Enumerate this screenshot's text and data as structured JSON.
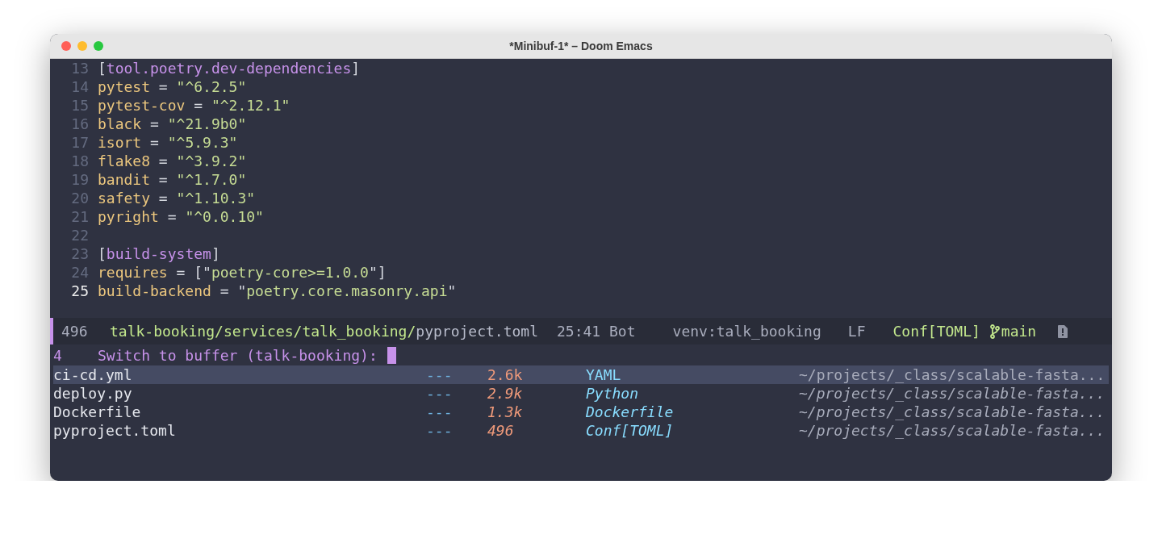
{
  "window": {
    "title": "*Minibuf-1* – Doom Emacs"
  },
  "editor": {
    "lines": [
      {
        "number": "13",
        "current": false,
        "tokens": [
          {
            "kind": "punct",
            "text": "["
          },
          {
            "kind": "section",
            "text": "tool.poetry.dev-dependencies"
          },
          {
            "kind": "punct",
            "text": "]"
          }
        ]
      },
      {
        "number": "14",
        "current": false,
        "tokens": [
          {
            "kind": "key",
            "text": "pytest"
          },
          {
            "kind": "punct",
            "text": " = "
          },
          {
            "kind": "string",
            "text": "\"^6.2.5\""
          }
        ]
      },
      {
        "number": "15",
        "current": false,
        "tokens": [
          {
            "kind": "key",
            "text": "pytest-cov"
          },
          {
            "kind": "punct",
            "text": " = "
          },
          {
            "kind": "string",
            "text": "\"^2.12.1\""
          }
        ]
      },
      {
        "number": "16",
        "current": false,
        "tokens": [
          {
            "kind": "key",
            "text": "black"
          },
          {
            "kind": "punct",
            "text": " = "
          },
          {
            "kind": "string",
            "text": "\"^21.9b0\""
          }
        ]
      },
      {
        "number": "17",
        "current": false,
        "tokens": [
          {
            "kind": "key",
            "text": "isort"
          },
          {
            "kind": "punct",
            "text": " = "
          },
          {
            "kind": "string",
            "text": "\"^5.9.3\""
          }
        ]
      },
      {
        "number": "18",
        "current": false,
        "tokens": [
          {
            "kind": "key",
            "text": "flake8"
          },
          {
            "kind": "punct",
            "text": " = "
          },
          {
            "kind": "string",
            "text": "\"^3.9.2\""
          }
        ]
      },
      {
        "number": "19",
        "current": false,
        "tokens": [
          {
            "kind": "key",
            "text": "bandit"
          },
          {
            "kind": "punct",
            "text": " = "
          },
          {
            "kind": "string",
            "text": "\"^1.7.0\""
          }
        ]
      },
      {
        "number": "20",
        "current": false,
        "tokens": [
          {
            "kind": "key",
            "text": "safety"
          },
          {
            "kind": "punct",
            "text": " = "
          },
          {
            "kind": "string",
            "text": "\"^1.10.3\""
          }
        ]
      },
      {
        "number": "21",
        "current": false,
        "tokens": [
          {
            "kind": "key",
            "text": "pyright"
          },
          {
            "kind": "punct",
            "text": " = "
          },
          {
            "kind": "string",
            "text": "\"^0.0.10\""
          }
        ]
      },
      {
        "number": "22",
        "current": false
      },
      {
        "number": "23",
        "current": false,
        "tokens": [
          {
            "kind": "punct",
            "text": "["
          },
          {
            "kind": "section",
            "text": "build-system"
          },
          {
            "kind": "punct",
            "text": "]"
          }
        ]
      },
      {
        "number": "24",
        "current": false,
        "tokens": [
          {
            "kind": "key",
            "text": "requires"
          },
          {
            "kind": "punct",
            "text": " = [\""
          },
          {
            "kind": "string",
            "text": "poetry-core>=1.0.0"
          },
          {
            "kind": "punct",
            "text": "\"]"
          }
        ]
      },
      {
        "number": "25",
        "current": true,
        "tokens": [
          {
            "kind": "key",
            "text": "build-backend"
          },
          {
            "kind": "punct",
            "text": " = \""
          },
          {
            "kind": "string",
            "text": "poetry.core.masonry.api"
          },
          {
            "kind": "punct",
            "text": "\""
          }
        ]
      }
    ]
  },
  "modeline": {
    "size": "496",
    "path_dir": "talk-booking/services/talk_booking/",
    "path_file": "pyproject.toml",
    "position": "25:41 Bot",
    "venv": "venv:talk_booking",
    "eol": "LF",
    "mode": "Conf[TOML]",
    "branch": "main"
  },
  "minibuffer": {
    "count": "4",
    "prompt": "Switch to buffer (talk-booking):"
  },
  "completions": [
    {
      "name": "ci-cd.yml",
      "modified": "---",
      "size": "2.6k",
      "mode": "YAML",
      "path": "~/projects/_class/scalable-fasta...",
      "selected": true
    },
    {
      "name": "deploy.py",
      "modified": "---",
      "size": "2.9k",
      "mode": "Python",
      "path": "~/projects/_class/scalable-fasta...",
      "selected": false
    },
    {
      "name": "Dockerfile",
      "modified": "---",
      "size": "1.3k",
      "mode": "Dockerfile",
      "path": "~/projects/_class/scalable-fasta...",
      "selected": false
    },
    {
      "name": "pyproject.toml",
      "modified": "---",
      "size": "496",
      "mode": "Conf[TOML]",
      "path": "~/projects/_class/scalable-fasta...",
      "selected": false
    }
  ]
}
